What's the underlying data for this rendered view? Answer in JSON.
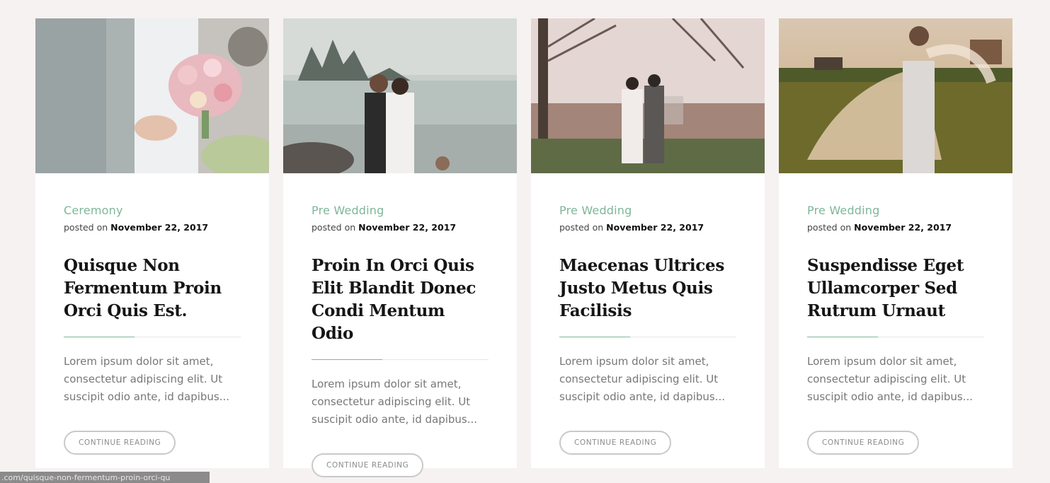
{
  "posts": [
    {
      "image_alt": "bride holding bouquet next to groom",
      "category": "Ceremony",
      "posted_prefix": "posted on",
      "date": "November 22, 2017",
      "title": "Quisque Non Fermentum Proin Orci Quis Est.",
      "excerpt": "Lorem ipsum dolor sit amet, consectetur adipiscing elit. Ut suscipit odio ante, id dapibus...",
      "button": "Continue Reading"
    },
    {
      "image_alt": "couple kissing by a misty lake",
      "category": "Pre Wedding",
      "posted_prefix": "posted on",
      "date": "November 22, 2017",
      "title": "Proin In Orci Quis Elit Blandit Donec Condi Mentum Odio",
      "excerpt": "Lorem ipsum dolor sit amet, consectetur adipiscing elit. Ut suscipit odio ante, id dapibus...",
      "button": "Continue Reading"
    },
    {
      "image_alt": "couple standing in a foggy park",
      "category": "Pre Wedding",
      "posted_prefix": "posted on",
      "date": "November 22, 2017",
      "title": "Maecenas Ultrices Justo Metus Quis Facilisis",
      "excerpt": "Lorem ipsum dolor sit amet, consectetur adipiscing elit. Ut suscipit odio ante, id dapibus...",
      "button": "Continue Reading"
    },
    {
      "image_alt": "bride with veil in a sunset field",
      "category": "Pre Wedding",
      "posted_prefix": "posted on",
      "date": "November 22, 2017",
      "title": "Suspendisse Eget Ullamcorper Sed Rutrum Urnaut",
      "excerpt": "Lorem ipsum dolor sit amet, consectetur adipiscing elit. Ut suscipit odio ante, id dapibus...",
      "button": "Continue Reading"
    }
  ],
  "status_bar": {
    "url": ".com/quisque-non-fermentum-proin-orci-qu"
  },
  "colors": {
    "accent": "#7eb798",
    "page_background": "#f6f2f1"
  }
}
